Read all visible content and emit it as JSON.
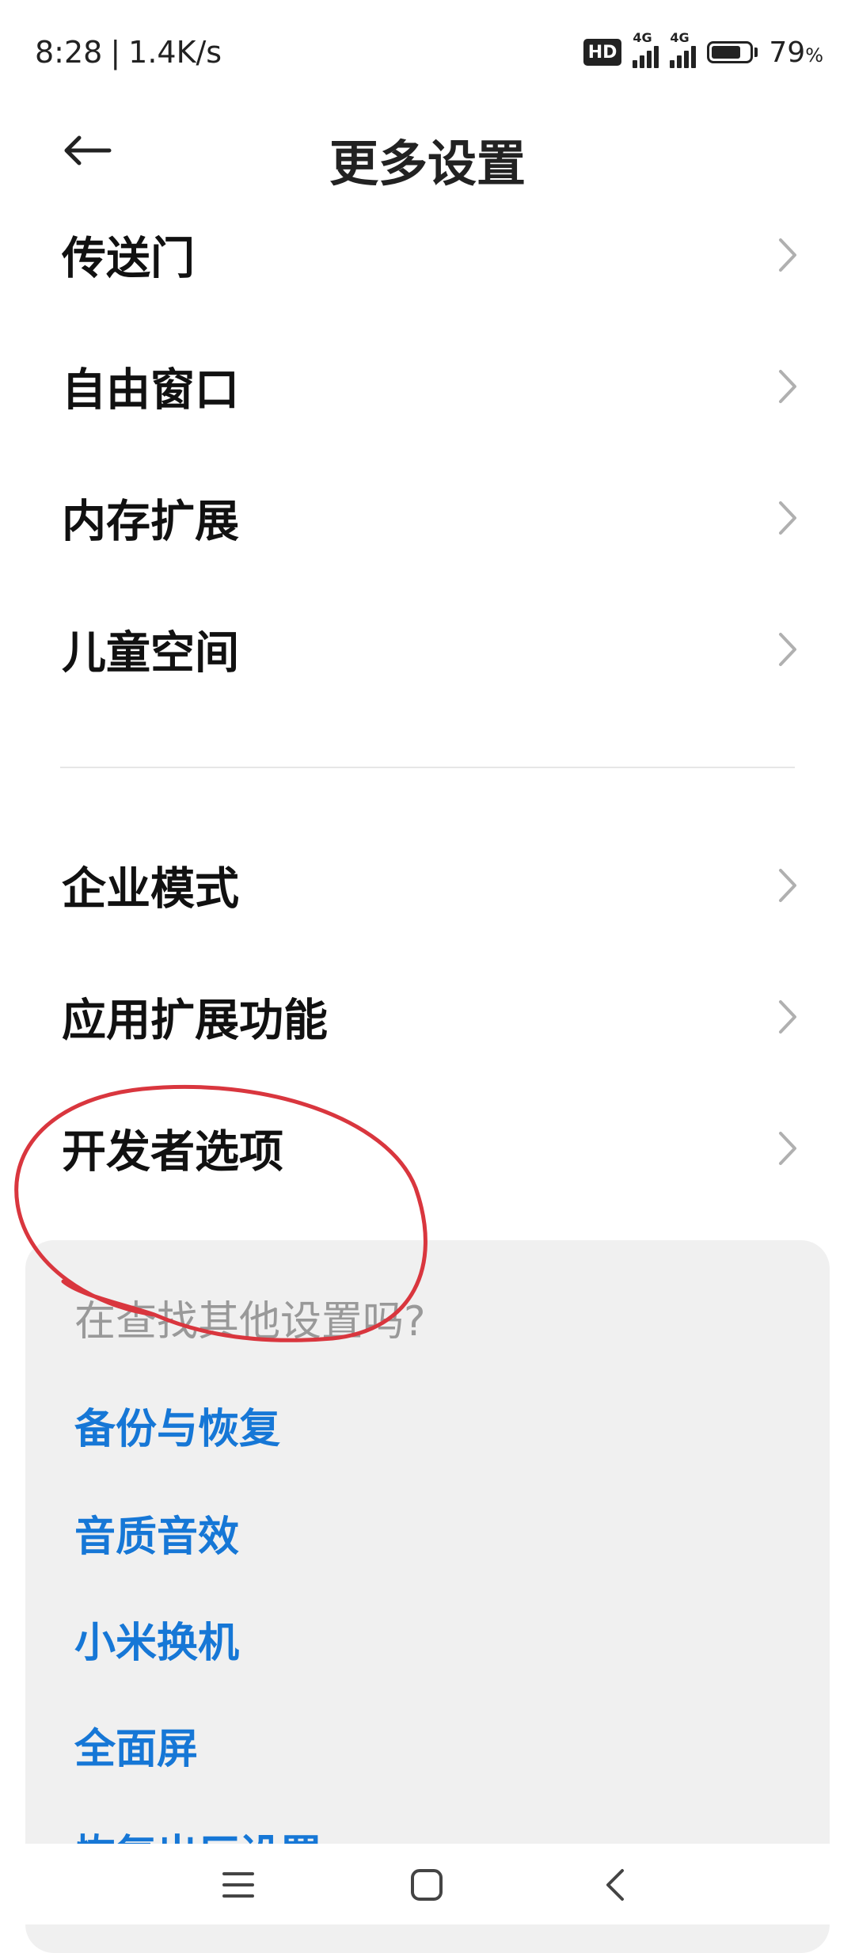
{
  "status_bar": {
    "time": "8:28",
    "separator": "|",
    "net_speed": "1.4K/s",
    "hd_label": "HD",
    "signal1_tag": "4G",
    "signal2_tag": "4G",
    "battery_level": 79,
    "battery_value": "79",
    "battery_unit": "%"
  },
  "header": {
    "title": "更多设置",
    "back_icon": "arrow-left-icon"
  },
  "list": {
    "items": [
      {
        "label": "传送门"
      },
      {
        "label": "自由窗口"
      },
      {
        "label": "内存扩展"
      },
      {
        "label": "儿童空间"
      },
      {
        "label": "企业模式"
      },
      {
        "label": "应用扩展功能"
      },
      {
        "label": "开发者选项"
      }
    ],
    "chevron_icon": "chevron-right-icon"
  },
  "suggestions": {
    "title": "在查找其他设置吗?",
    "links": [
      {
        "label": "备份与恢复"
      },
      {
        "label": "音质音效"
      },
      {
        "label": "小米换机"
      },
      {
        "label": "全面屏"
      },
      {
        "label": "恢复出厂设置"
      }
    ]
  },
  "nav": {
    "menu_icon": "menu-icon",
    "home_icon": "home-square-icon",
    "back_icon": "back-chevron-icon"
  },
  "colors": {
    "link": "#1677d6",
    "annotation": "#d9363e",
    "card_bg": "#f0f0f0"
  }
}
